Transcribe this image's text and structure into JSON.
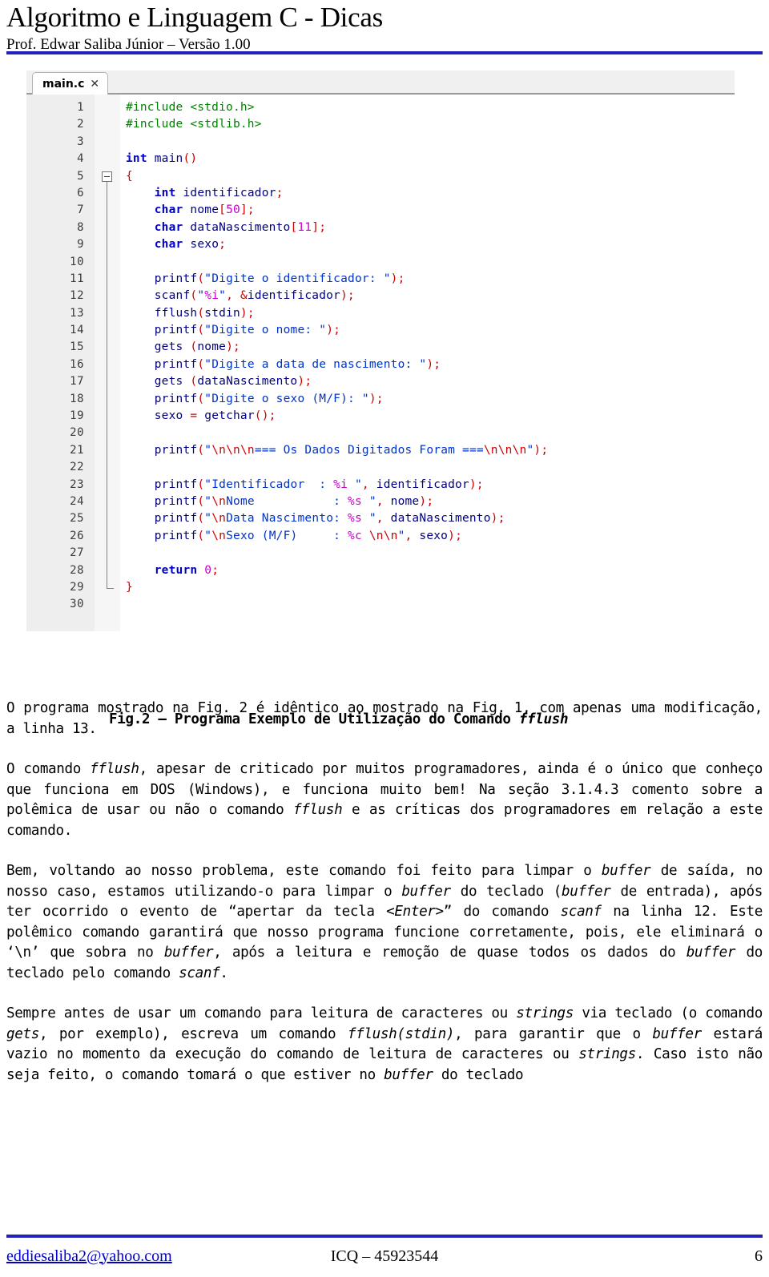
{
  "header": {
    "title": "Algoritmo e Linguagem C - Dicas",
    "subtitle": "Prof. Edwar Saliba Júnior – Versão 1.00",
    "rule_color": "#2222bb"
  },
  "editor": {
    "tab_label": "main.c",
    "tab_close": "✕",
    "gutter_bg": "#eeeeee",
    "lines": [
      {
        "n": "1",
        "code": "#include <stdio.h>"
      },
      {
        "n": "2",
        "code": "#include <stdlib.h>"
      },
      {
        "n": "3",
        "code": ""
      },
      {
        "n": "4",
        "code": "int main()"
      },
      {
        "n": "5",
        "code": "{"
      },
      {
        "n": "6",
        "code": "    int identificador;"
      },
      {
        "n": "7",
        "code": "    char nome[50];"
      },
      {
        "n": "8",
        "code": "    char dataNascimento[11];"
      },
      {
        "n": "9",
        "code": "    char sexo;"
      },
      {
        "n": "10",
        "code": ""
      },
      {
        "n": "11",
        "code": "    printf(\"Digite o identificador: \");"
      },
      {
        "n": "12",
        "code": "    scanf(\"%i\", &identificador);"
      },
      {
        "n": "13",
        "code": "    fflush(stdin);"
      },
      {
        "n": "14",
        "code": "    printf(\"Digite o nome: \");"
      },
      {
        "n": "15",
        "code": "    gets (nome);"
      },
      {
        "n": "16",
        "code": "    printf(\"Digite a data de nascimento: \");"
      },
      {
        "n": "17",
        "code": "    gets (dataNascimento);"
      },
      {
        "n": "18",
        "code": "    printf(\"Digite o sexo (M/F): \");"
      },
      {
        "n": "19",
        "code": "    sexo = getchar();"
      },
      {
        "n": "20",
        "code": ""
      },
      {
        "n": "21",
        "code": "    printf(\"\\n\\n\\n=== Os Dados Digitados Foram ===\\n\\n\\n\");"
      },
      {
        "n": "22",
        "code": ""
      },
      {
        "n": "23",
        "code": "    printf(\"Identificador  : %i \", identificador);"
      },
      {
        "n": "24",
        "code": "    printf(\"\\nNome           : %s \", nome);"
      },
      {
        "n": "25",
        "code": "    printf(\"\\nData Nascimento: %s \", dataNascimento);"
      },
      {
        "n": "26",
        "code": "    printf(\"\\nSexo (M/F)     : %c \\n\\n\", sexo);"
      },
      {
        "n": "27",
        "code": ""
      },
      {
        "n": "28",
        "code": "    return 0;"
      },
      {
        "n": "29",
        "code": "}"
      },
      {
        "n": "30",
        "code": ""
      }
    ],
    "fold_marker_line": 5
  },
  "figure": {
    "caption_prefix": "Fig.2 – Programa Exemplo de Utilização do Comando ",
    "caption_italic": "fflush"
  },
  "body": {
    "paragraphs": [
      "O programa mostrado na Fig. 2 é idêntico ao mostrado na Fig. 1, com apenas uma modificação, a linha 13.",
      "O comando fflush, apesar de criticado por muitos programadores, ainda é o único que conheço que funciona em DOS (Windows), e funciona muito bem! Na seção 3.1.4.3 comento sobre a polêmica de usar ou não o comando fflush e as críticas dos programadores em relação a este comando.",
      "Bem, voltando ao nosso problema, este comando foi feito para limpar o buffer de saída, no nosso caso, estamos utilizando-o para limpar o buffer do teclado (buffer de entrada), após ter ocorrido o evento de “apertar da tecla <Enter>” do comando scanf na linha 12. Este polêmico comando garantirá que nosso programa funcione corretamente, pois, ele eliminará o ‘\\n’ que sobra no buffer, após a leitura e remoção de quase todos os dados do buffer do teclado pelo comando scanf.",
      "Sempre antes de usar um comando para leitura de caracteres ou strings via teclado (o comando gets, por exemplo), escreva um comando fflush(stdin), para garantir que o buffer estará vazio no momento da execução do comando de leitura de caracteres ou strings. Caso isto não seja feito, o comando tomará o que estiver no buffer do teclado"
    ]
  },
  "footer": {
    "email": "eddiesaliba2@yahoo.com",
    "icq": "ICQ – 45923544",
    "page_number": "6"
  }
}
